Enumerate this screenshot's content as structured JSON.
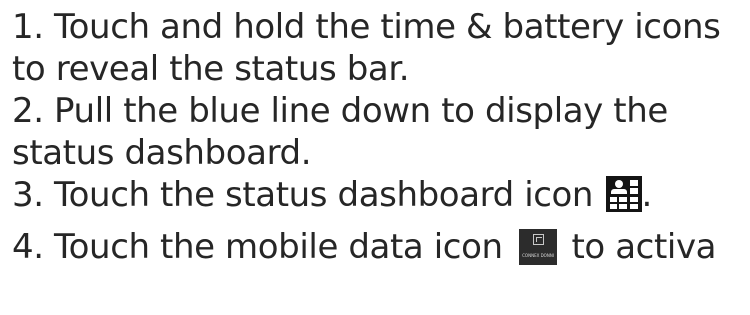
{
  "steps": [
    {
      "line1": "1. Touch and hold the time & battery icons",
      "line2": "to reveal the status bar."
    },
    {
      "line1": "2. Pull the blue line down to display the",
      "line2": "status dashboard."
    },
    {
      "text": "3. Touch the status dashboard icon",
      "suffix": ".",
      "icon": "status-dashboard-icon"
    },
    {
      "text": "4. Touch the mobile data icon",
      "after": "to activa",
      "icon": "mobile-data-icon",
      "icon_caption": "CONNEX DONNI"
    }
  ]
}
